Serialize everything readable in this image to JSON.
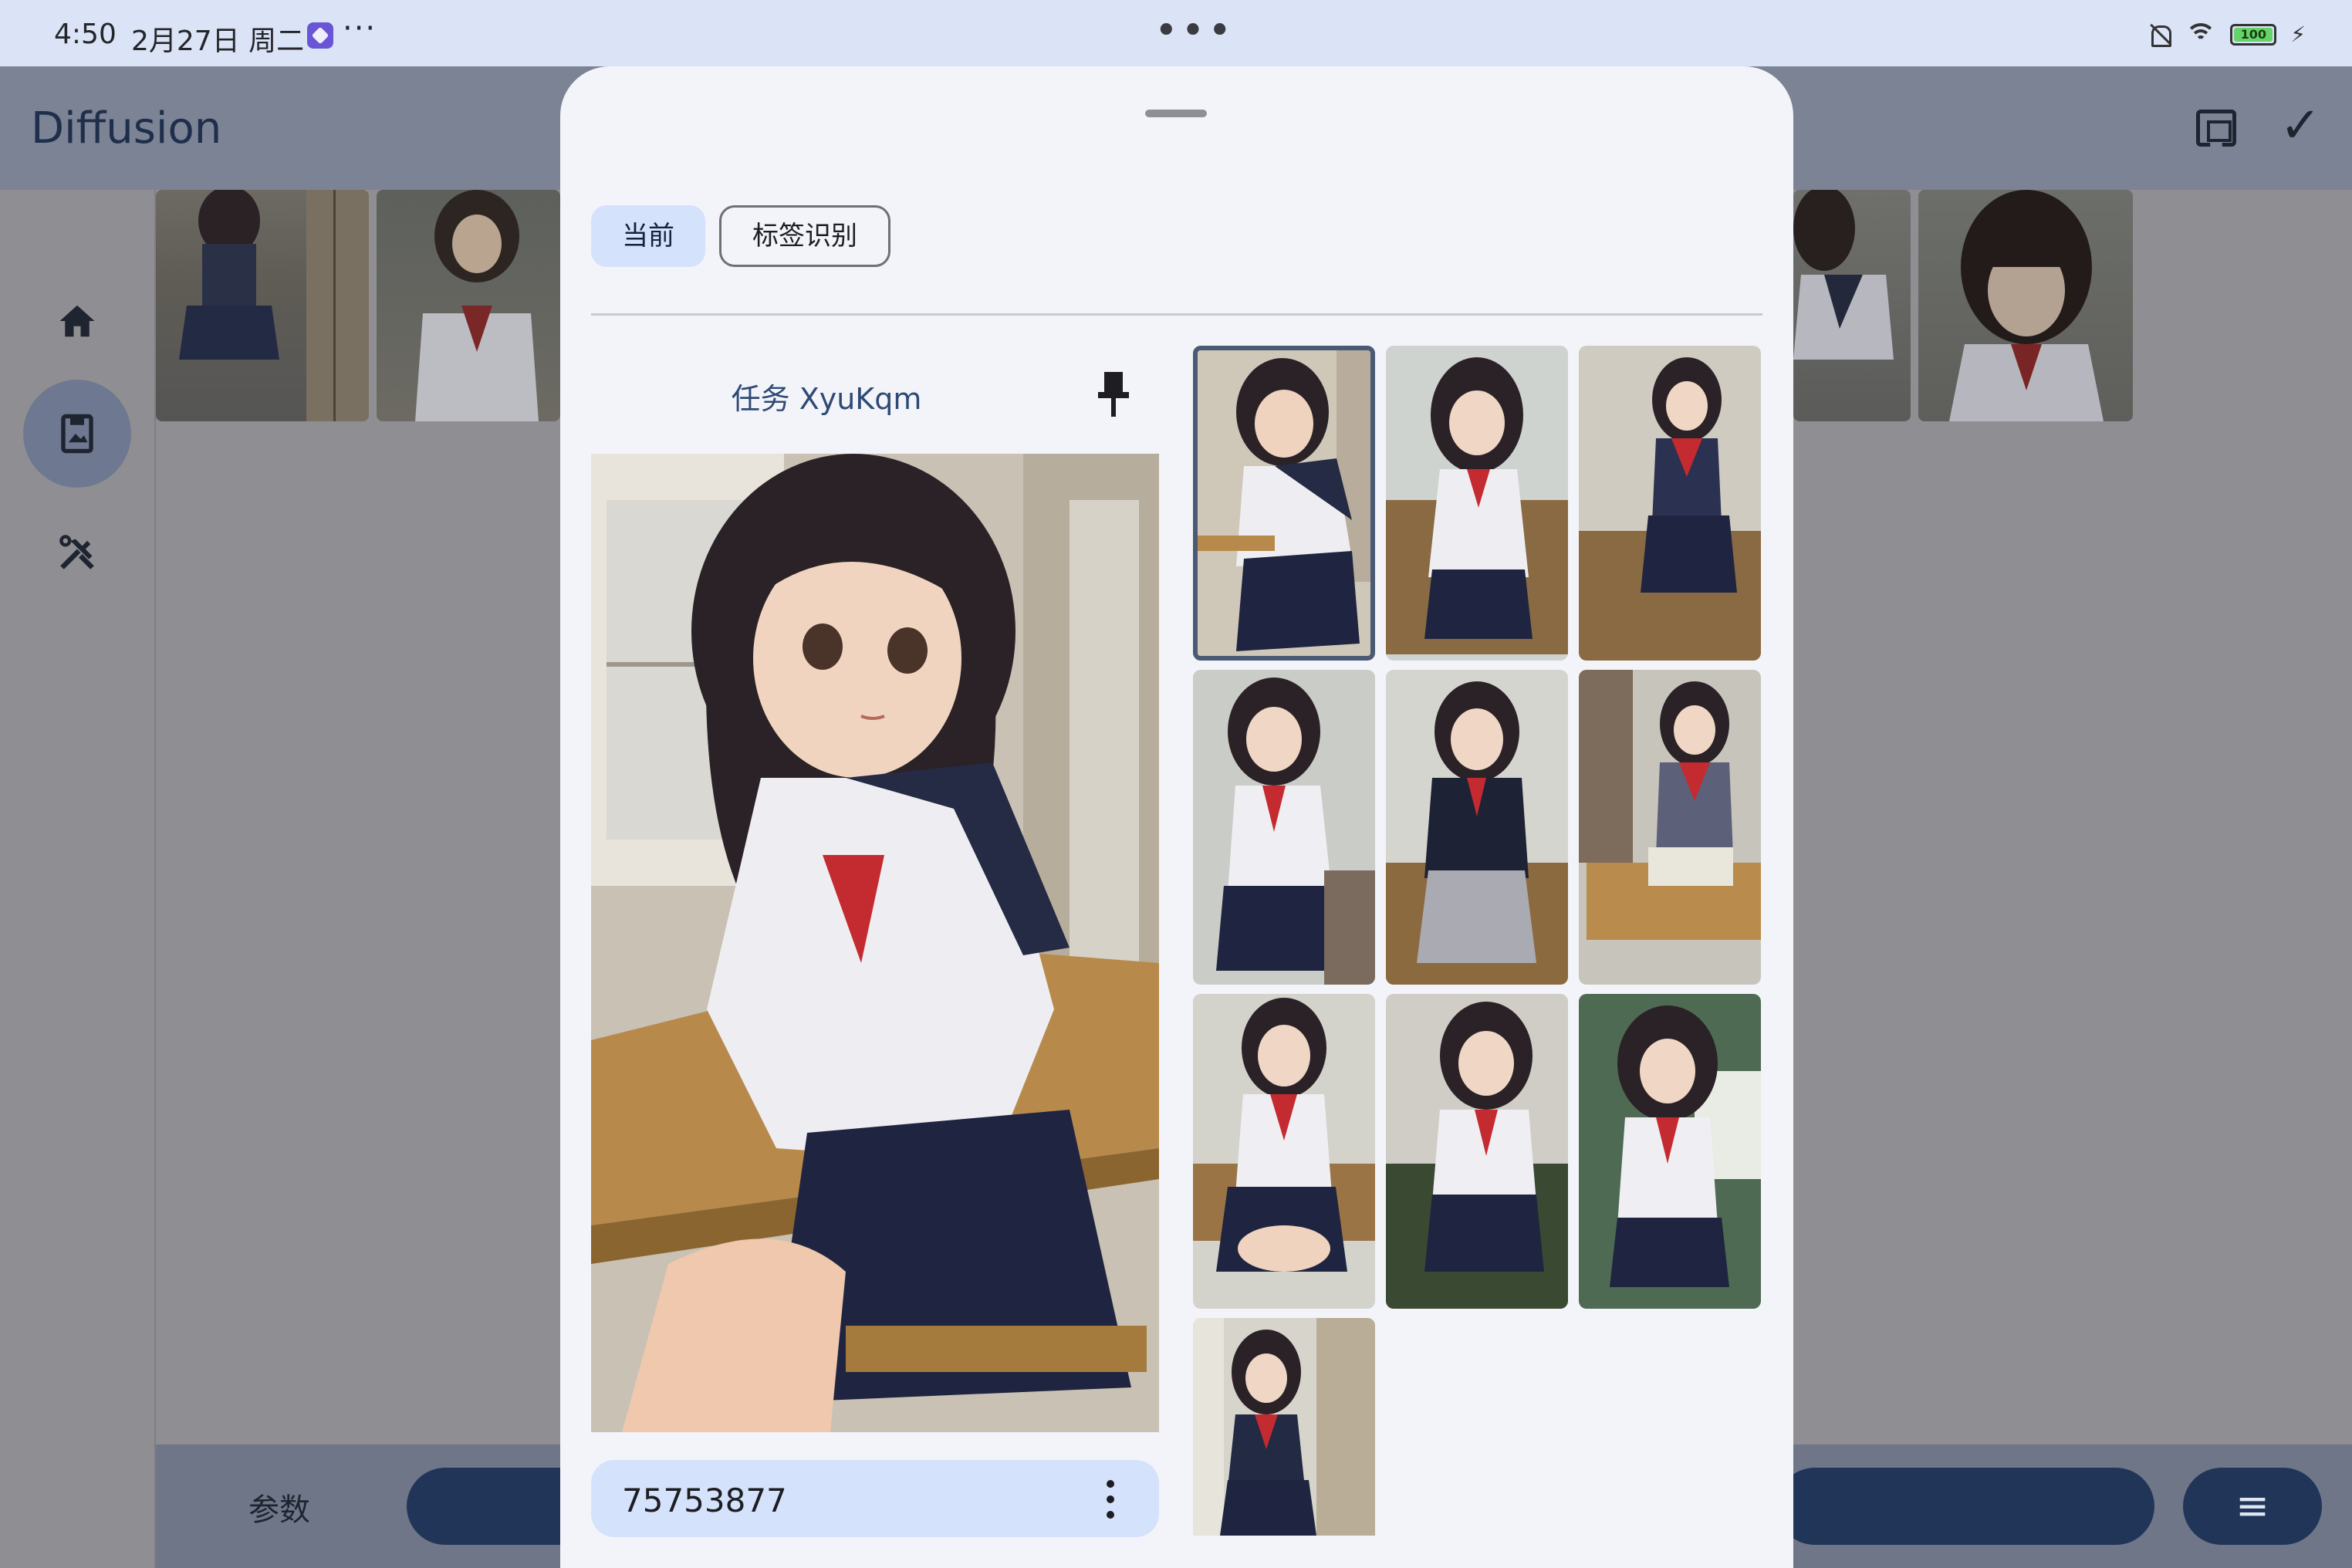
{
  "status_bar": {
    "time": "4:50",
    "date": "2月27日 周二",
    "more": "···",
    "center_dots": "•••",
    "battery": "100"
  },
  "app": {
    "title": "Diffusion",
    "nav": [
      {
        "name": "home",
        "icon": "home-icon"
      },
      {
        "name": "gallery",
        "icon": "photo-album-icon",
        "active": true
      },
      {
        "name": "tools",
        "icon": "tools-icon"
      }
    ],
    "bottom": {
      "params_label": "参数",
      "menu_icon": "≡"
    }
  },
  "sheet": {
    "tabs": [
      {
        "label": "当前",
        "selected": true
      },
      {
        "label": "标签识别",
        "selected": false
      }
    ],
    "task_title": "任务 XyuKqm",
    "seed": "75753877",
    "grid_count": 10,
    "selected_index": 0
  },
  "colors": {
    "accent_container": "#d5e2fb",
    "primary_dark": "#213558",
    "title_blue": "#2e4a74"
  }
}
